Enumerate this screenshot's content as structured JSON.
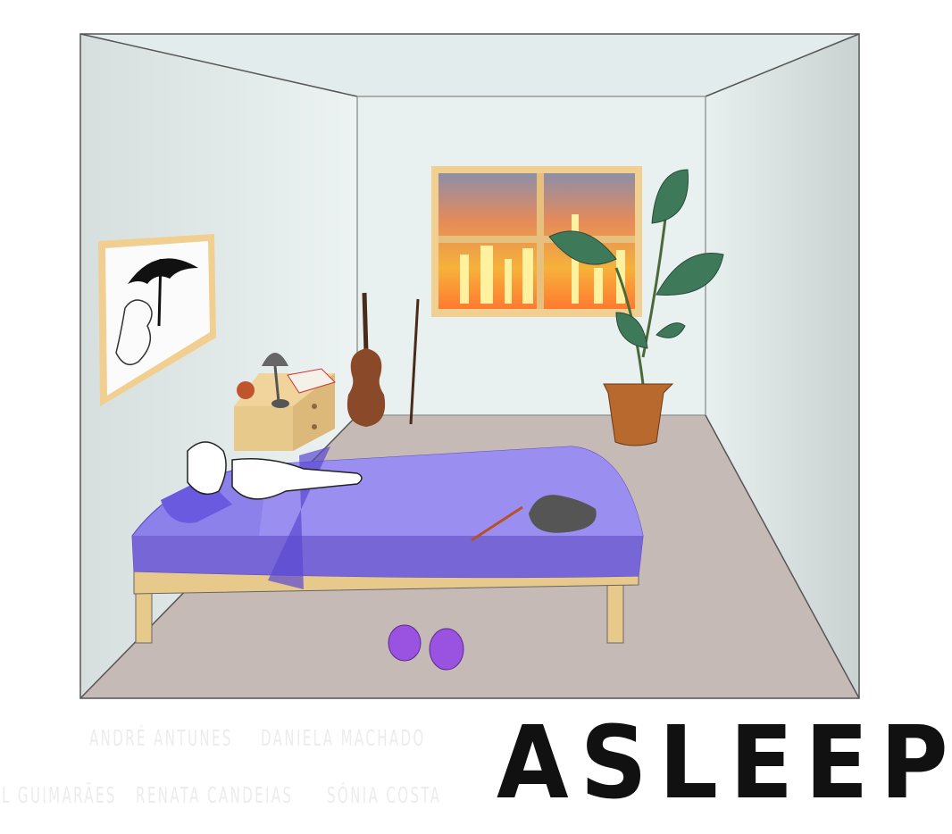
{
  "title": "ASLEEP",
  "credits": {
    "row1": [
      "ANDRÉ ANTUNES",
      "DANIELA MACHADO"
    ],
    "row2": [
      "L GUIMARÃES",
      "RENATA CANDEIAS",
      "SÓNIA COSTA"
    ]
  },
  "colors": {
    "wall": "#e6efee",
    "back_wall": "#e9f1f0",
    "floor": "#c6bab6",
    "bed_sheet": "#8c80ea",
    "bed_frame": "#e8c98c",
    "sky": "#f08a3a",
    "plant": "#3e7a5a",
    "pot": "#b8692d",
    "slippers": "#9a52e0"
  }
}
